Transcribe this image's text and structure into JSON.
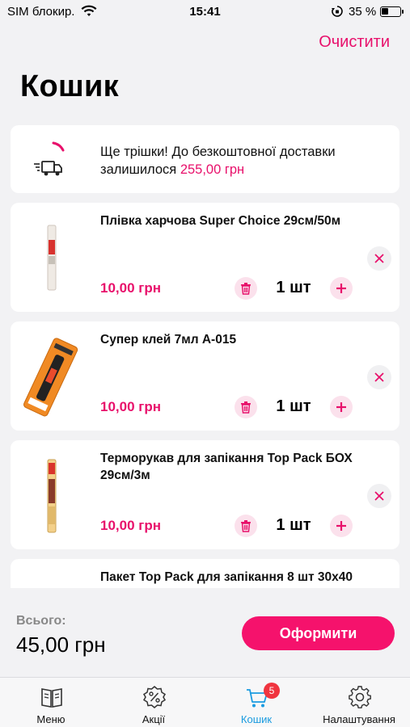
{
  "status_bar": {
    "carrier": "SIM блокир.",
    "time": "15:41",
    "battery_percent": "35 %",
    "icons": [
      "wifi-icon",
      "rotation-lock-icon",
      "battery-icon"
    ]
  },
  "header": {
    "clear_label": "Очистити",
    "title": "Кошик"
  },
  "delivery": {
    "icon": "delivery-truck-icon",
    "message": "Ще трішки! До безкоштовної доставки залишилося",
    "remaining": "255,00 грн"
  },
  "cart_items": [
    {
      "name": "Плівка харчова Super Choice 29см/50м",
      "price": "10,00 грн",
      "quantity": "1 шт"
    },
    {
      "name": "Супер клей 7мл A-015",
      "price": "10,00 грн",
      "quantity": "1 шт"
    },
    {
      "name": "Терморукав для запікання Top Pack БОХ 29см/3м",
      "price": "10,00 грн",
      "quantity": "1 шт"
    },
    {
      "name": "Пакет Top Pack для запікання 8 шт 30x40",
      "price": "",
      "quantity": ""
    }
  ],
  "checkout": {
    "total_label": "Всього:",
    "total_value": "45,00 грн",
    "button_label": "Оформити"
  },
  "tabs": [
    {
      "label": "Меню",
      "icon": "menu-book-icon"
    },
    {
      "label": "Акції",
      "icon": "discount-badge-icon"
    },
    {
      "label": "Кошик",
      "icon": "cart-icon",
      "badge": "5",
      "active": true
    },
    {
      "label": "Налаштування",
      "icon": "settings-gear-icon"
    }
  ],
  "colors": {
    "accent": "#e8106b",
    "checkout_button": "#f5126c",
    "active_tab": "#1a9be0",
    "badge": "#f0343f"
  }
}
